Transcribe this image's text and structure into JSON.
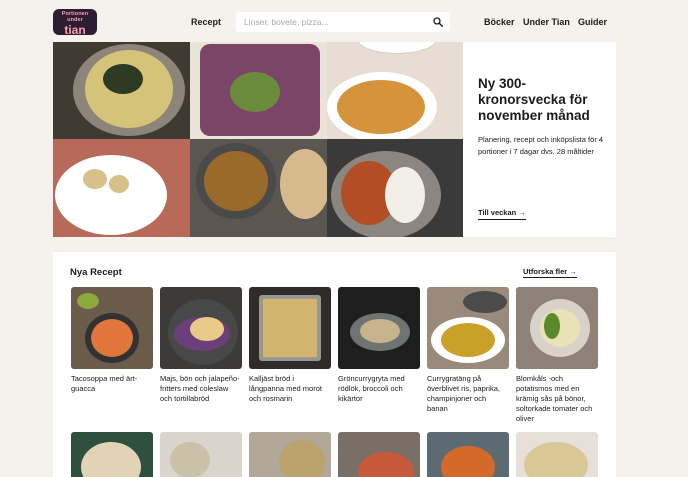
{
  "header": {
    "logo_line1": "Portionen",
    "logo_line2": "under",
    "logo_line3": "tian",
    "nav_left": "Recept",
    "search_placeholder": "Linser, bovete, pizza...",
    "nav_right": [
      "Böcker",
      "Under Tian",
      "Guider"
    ]
  },
  "hero": {
    "title": "Ny 300-kronorsvecka för november månad",
    "description": "Planering, recept och inköpslista för 4 portioner i 7 dagar dvs. 28 måltider",
    "link": "Till veckan"
  },
  "new_recipes": {
    "title": "Nya Recept",
    "explore": "Utforska fler",
    "items": [
      "Tacosoppa med ärt-guacca",
      "Majs, bön och jalapeño-fritters med coleslaw och tortillabröd",
      "Kalljäst bröd i långpanna med morot och rosmarin",
      "Gröncurrygryta med rödlök, broccoli och kikärtor",
      "Currygratäng på överblivet ris, paprika, champinjoner och banan",
      "Blomkåls -och potatismos med en krämig sås på bönor, soltorkade tomater och oliver"
    ]
  },
  "colors": {
    "background": "#f5f1ec",
    "logo_bg": "#2d1d33",
    "logo_text": "#ff9fb0"
  }
}
